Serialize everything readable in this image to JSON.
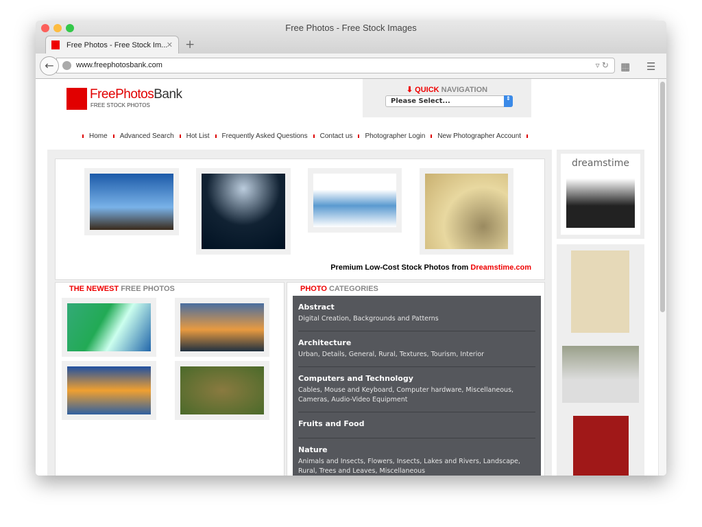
{
  "window": {
    "title": "Free Photos - Free Stock Images",
    "tab_label": "Free Photos - Free Stock Im...",
    "url": "www.freephotosbank.com"
  },
  "logo": {
    "free": "Free",
    "photos": "Photos",
    "bank": "Bank",
    "tagline": "FREE STOCK PHOTOS"
  },
  "quick_nav": {
    "title_red": "QUICK",
    "title_gray": "NAVIGATION",
    "select_value": "Please Select..."
  },
  "nav": [
    "Home",
    "Advanced Search",
    "Hot List",
    "Frequently Asked Questions",
    "Contact us",
    "Photographer Login",
    "New Photographer Account"
  ],
  "featured": {
    "caption_prefix": "Premium Low-Cost Stock Photos from ",
    "caption_link": "Dreamstime.com"
  },
  "newest": {
    "title_red": "THE NEWEST",
    "title_gray": "FREE PHOTOS"
  },
  "categories": {
    "title_red": "PHOTO",
    "title_gray": "CATEGORIES",
    "items": [
      {
        "name": "Abstract",
        "sub": "Digital Creation, Backgrounds and Patterns"
      },
      {
        "name": "Architecture",
        "sub": "Urban, Details, General, Rural, Textures, Tourism, Interior"
      },
      {
        "name": "Computers and Technology",
        "sub": "Cables, Mouse and Keyboard, Computer hardware, Miscellaneous, Cameras, Audio-Video Equipment"
      },
      {
        "name": "Fruits and Food",
        "sub": ""
      },
      {
        "name": "Nature",
        "sub": "Animals and Insects, Flowers, Insects, Lakes and Rivers, Landscape, Rural, Trees and Leaves, Miscellaneous"
      }
    ]
  },
  "sidebar": {
    "ad_brand": "dreamstime"
  },
  "colors": {
    "accent": "#e10000",
    "category_bg": "#55575c"
  }
}
